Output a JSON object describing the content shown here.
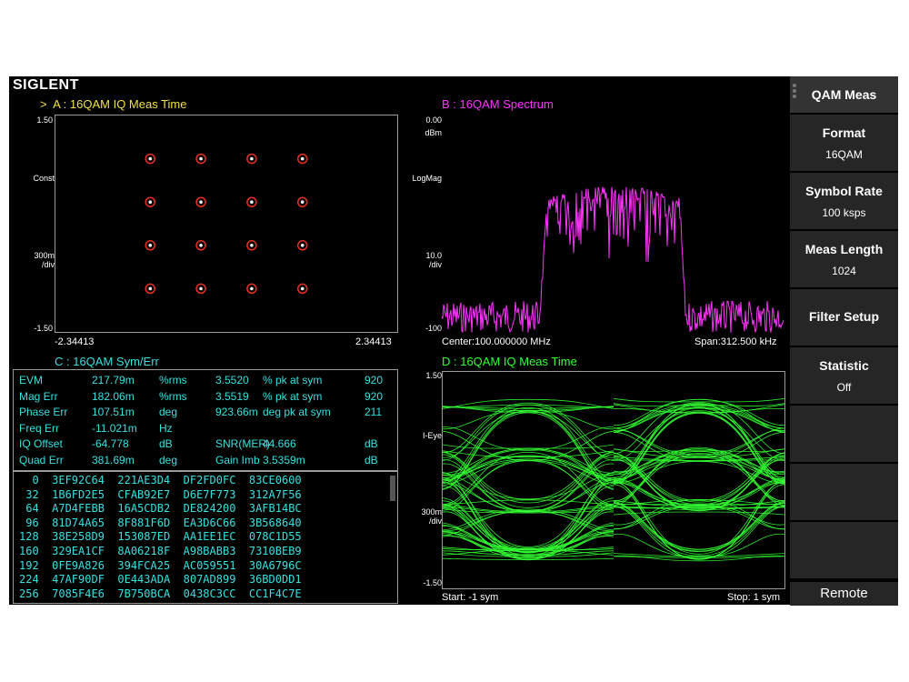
{
  "brand": "SIGLENT",
  "panel_a": {
    "title": "A :  16QAM  IQ Meas Time",
    "marker": ">",
    "y_top": "1.50",
    "y_label": "Const",
    "y_scale": "300m\n/div",
    "y_bottom": "-1.50",
    "x_left": "-2.34413",
    "x_right": "2.34413",
    "constellation_points": [
      [
        -0.9,
        0.9
      ],
      [
        -0.3,
        0.9
      ],
      [
        0.3,
        0.9
      ],
      [
        0.9,
        0.9
      ],
      [
        -0.9,
        0.3
      ],
      [
        -0.3,
        0.3
      ],
      [
        0.3,
        0.3
      ],
      [
        0.9,
        0.3
      ],
      [
        -0.9,
        -0.3
      ],
      [
        -0.3,
        -0.3
      ],
      [
        0.3,
        -0.3
      ],
      [
        0.9,
        -0.3
      ],
      [
        -0.9,
        -0.9
      ],
      [
        -0.3,
        -0.9
      ],
      [
        0.3,
        -0.9
      ],
      [
        0.9,
        -0.9
      ]
    ],
    "point_color": "#e83020"
  },
  "panel_b": {
    "title": "B :  16QAM  Spectrum",
    "y_top": "0.00",
    "y_unit": "dBm",
    "y_label": "LogMag",
    "y_scale": "10.0\n/div",
    "y_bottom": "-100",
    "x_left": "Center:100.000000 MHz",
    "x_right": "Span:312.500 kHz",
    "trace_color": "#ff33ff"
  },
  "panel_c": {
    "title": "C :  16QAM  Sym/Err",
    "metrics": [
      {
        "name": "EVM",
        "value": "217.79m",
        "unit": "%rms",
        "v2": "3.5520",
        "label3": "% pk at sym",
        "v3": "920"
      },
      {
        "name": "Mag Err",
        "value": "182.06m",
        "unit": "%rms",
        "v2": "3.5519",
        "label3": "% pk at sym",
        "v3": "920"
      },
      {
        "name": "Phase Err",
        "value": "107.51m",
        "unit": "deg",
        "v2": "923.66m",
        "label3": "deg pk at sym",
        "v3": "211"
      },
      {
        "name": "Freq Err",
        "value": "-11.021m",
        "unit": "Hz",
        "v2": "",
        "label3": "",
        "v3": ""
      },
      {
        "name": "IQ Offset",
        "value": "-64.778",
        "unit": "dB",
        "v2": "SNR(MER)",
        "label3": "44.666",
        "v3": "dB"
      },
      {
        "name": "Quad Err",
        "value": "381.69m",
        "unit": "deg",
        "v2": "Gain Imb",
        "label3": "3.5359m",
        "v3": "dB"
      }
    ],
    "hex_rows": [
      "  0  3EF92C64  221AE3D4  DF2FD0FC  83CE0600",
      " 32  1B6FD2E5  CFAB92E7  D6E7F773  312A7F56",
      " 64  A7D4FEBB  16A5CDB2  DE824200  3AFB14BC",
      " 96  81D74A65  8F881F6D  EA3D6C66  3B568640",
      "128  38E258D9  153087ED  AA1EE1EC  078C1D55",
      "160  329EA1CF  8A06218F  A98BABB3  7310BEB9",
      "192  0FE9A826  394FCA25  AC059551  30A6796C",
      "224  47AF90DF  0E443ADA  807AD899  36BD0DD1",
      "256  7085F4E6  7B750BCA  0438C3CC  CC1F4C7E"
    ]
  },
  "panel_d": {
    "title": "D :  16QAM  IQ Meas Time",
    "y_top": "1.50",
    "y_label": "I-Eye",
    "y_scale": "300m\n/div",
    "y_bottom": "-1.50",
    "x_left": "Start: -1 sym",
    "x_right": "Stop: 1 sym",
    "trace_color": "#33ff33"
  },
  "softkeys": [
    {
      "label": "QAM Meas",
      "value": ""
    },
    {
      "label": "Format",
      "value": "16QAM"
    },
    {
      "label": "Symbol Rate",
      "value": "100 ksps"
    },
    {
      "label": "Meas Length",
      "value": "1024"
    },
    {
      "label": "Filter Setup",
      "value": ""
    },
    {
      "label": "Statistic",
      "value": "Off"
    },
    {
      "label": "",
      "value": ""
    },
    {
      "label": "",
      "value": ""
    },
    {
      "label": "",
      "value": ""
    }
  ],
  "remote_label": "Remote",
  "colors": {
    "panel_a_title": "#f0e040",
    "panel_b_title": "#ff33ff",
    "panel_c_title": "#36e0e0",
    "panel_d_title": "#33ff33"
  }
}
